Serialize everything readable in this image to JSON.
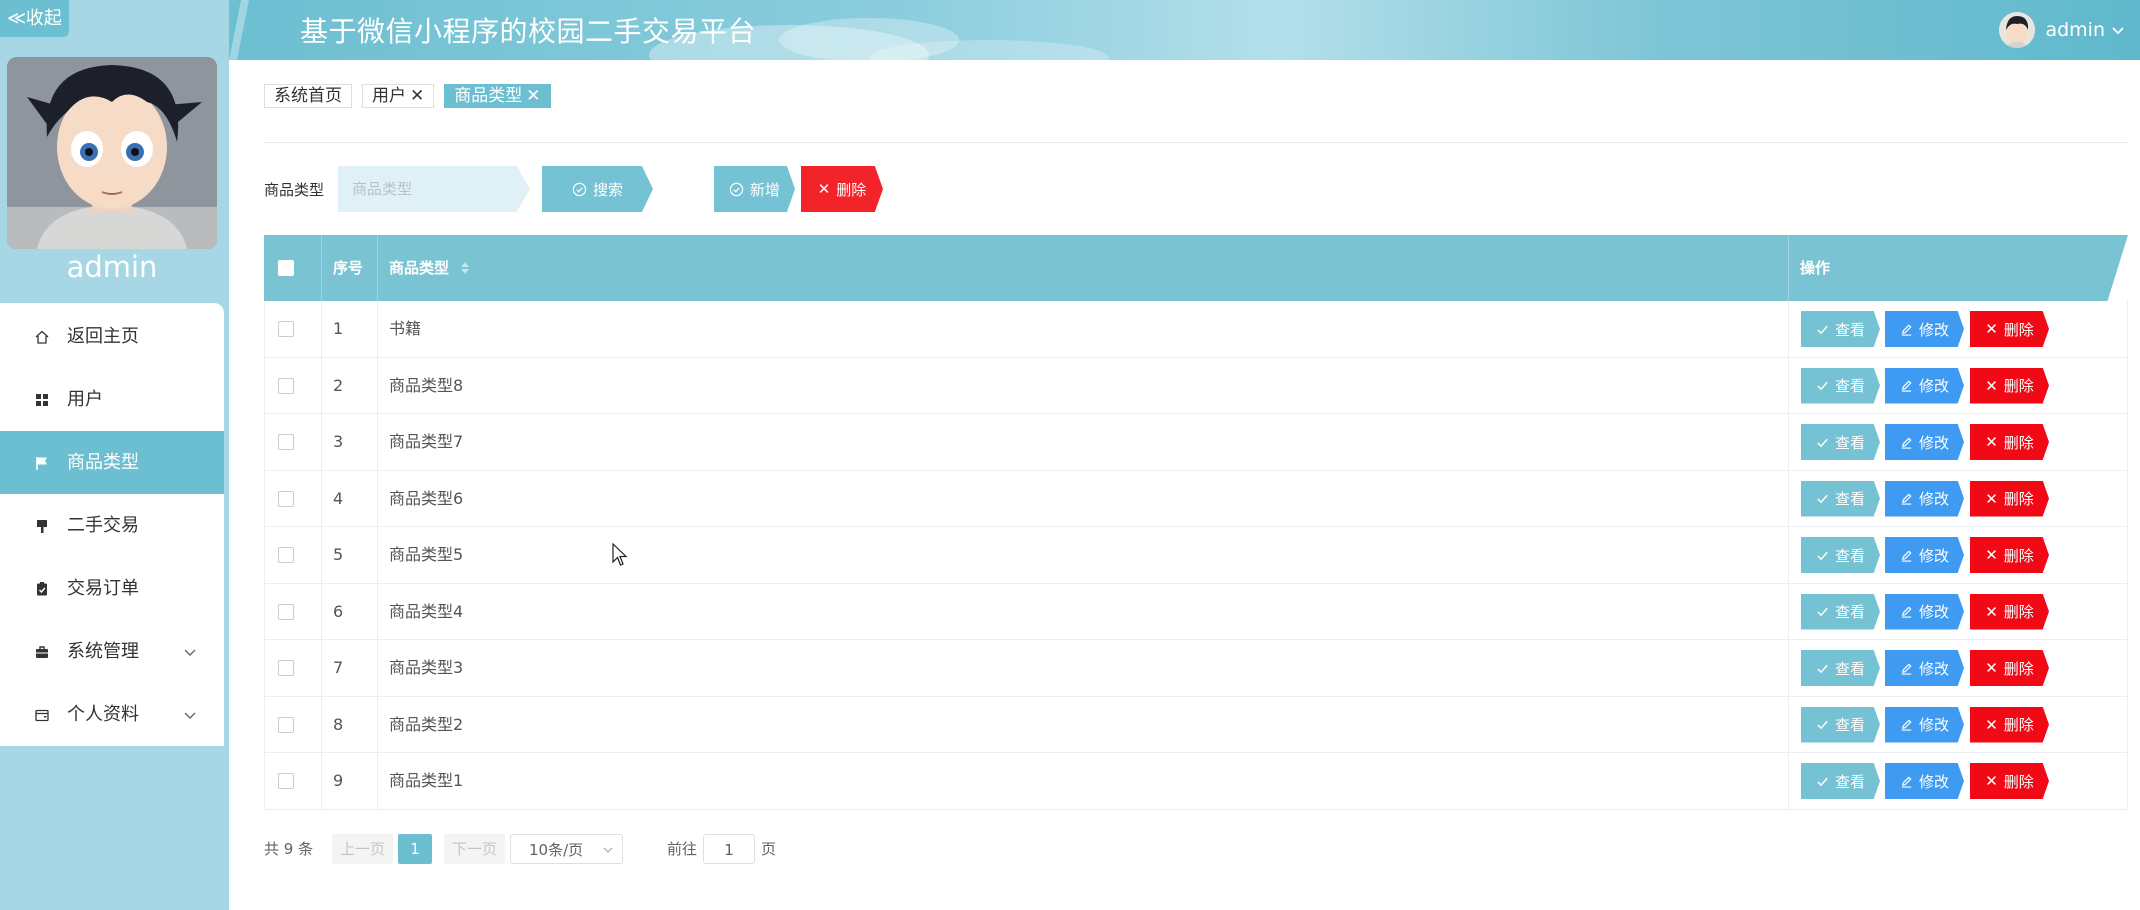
{
  "sidebar": {
    "collapse_label": "≪收起",
    "user_name": "admin",
    "menu": [
      {
        "label": "返回主页",
        "icon": "home-icon"
      },
      {
        "label": "用户",
        "icon": "grid-icon"
      },
      {
        "label": "商品类型",
        "icon": "flag-icon",
        "active": true
      },
      {
        "label": "二手交易",
        "icon": "brush-icon"
      },
      {
        "label": "交易订单",
        "icon": "clipboard-check-icon"
      },
      {
        "label": "系统管理",
        "icon": "briefcase-icon",
        "expandable": true
      },
      {
        "label": "个人资料",
        "icon": "wallet-icon",
        "expandable": true
      }
    ]
  },
  "header": {
    "title": "基于微信小程序的校园二手交易平台",
    "username": "admin"
  },
  "tags": [
    {
      "label": "系统首页"
    },
    {
      "label": "用户",
      "closable": true
    },
    {
      "label": "商品类型",
      "closable": true,
      "active": true
    }
  ],
  "search": {
    "label": "商品类型",
    "placeholder": "商品类型",
    "search_button": "搜索",
    "add_button": "新增",
    "delete_button": "删除"
  },
  "table": {
    "columns": [
      "序号",
      "商品类型",
      "操作"
    ],
    "rows": [
      {
        "index": "1",
        "type": "书籍"
      },
      {
        "index": "2",
        "type": "商品类型8"
      },
      {
        "index": "3",
        "type": "商品类型7"
      },
      {
        "index": "4",
        "type": "商品类型6"
      },
      {
        "index": "5",
        "type": "商品类型5"
      },
      {
        "index": "6",
        "type": "商品类型4"
      },
      {
        "index": "7",
        "type": "商品类型3"
      },
      {
        "index": "8",
        "type": "商品类型2"
      },
      {
        "index": "9",
        "type": "商品类型1"
      }
    ],
    "actions": {
      "view": "查看",
      "edit": "修改",
      "delete": "删除"
    }
  },
  "pagination": {
    "total": "共 9 条",
    "prev": "上一页",
    "current": "1",
    "next": "下一页",
    "page_size": "10条/页",
    "goto_label": "前往",
    "goto_value": "1",
    "page_suffix": "页"
  },
  "colors": {
    "accent": "#6cbfd1",
    "sidebar_bg": "#a7d7e4",
    "danger": "#f10a15",
    "edit_blue": "#3f9bf2"
  }
}
